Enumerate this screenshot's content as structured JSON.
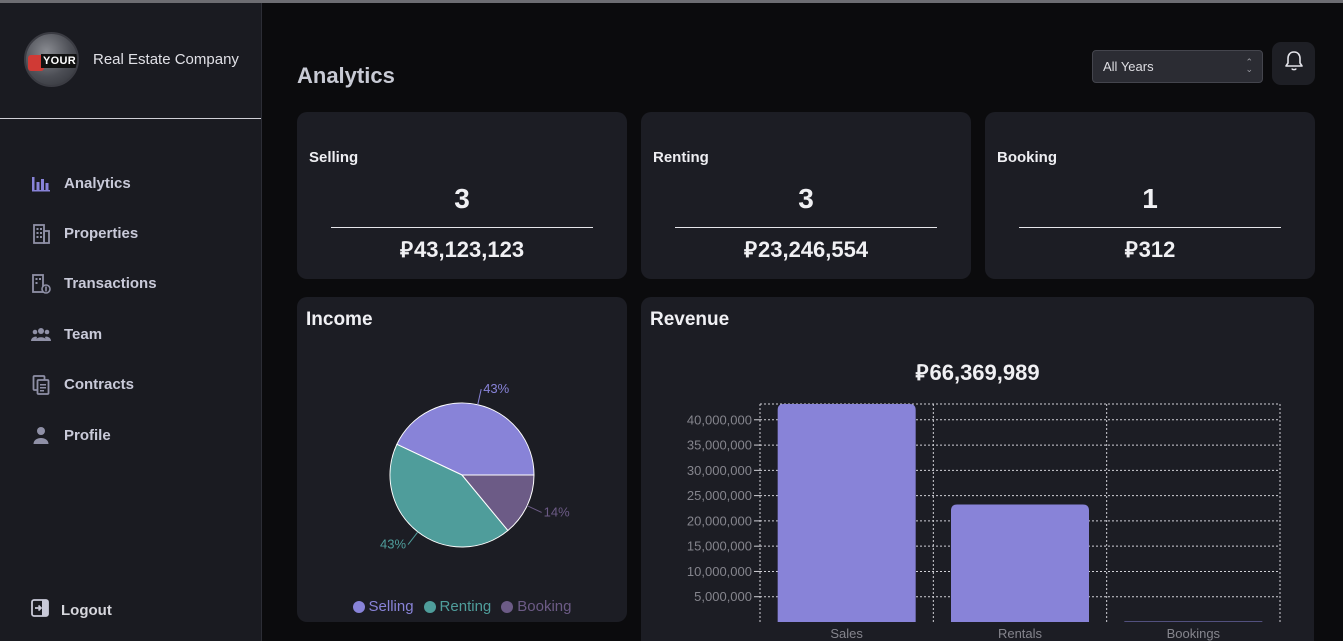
{
  "brand": {
    "name": "Real Estate Company",
    "logo_text": "YOUR"
  },
  "nav": [
    {
      "label": "Analytics",
      "icon": "bar-chart-icon",
      "active": true
    },
    {
      "label": "Properties",
      "icon": "building-icon",
      "active": false
    },
    {
      "label": "Transactions",
      "icon": "building-money-icon",
      "active": false
    },
    {
      "label": "Team",
      "icon": "team-icon",
      "active": false
    },
    {
      "label": "Contracts",
      "icon": "documents-icon",
      "active": false
    },
    {
      "label": "Profile",
      "icon": "user-icon",
      "active": false
    }
  ],
  "logout": {
    "label": "Logout",
    "icon": "logout-icon"
  },
  "header": {
    "title": "Analytics",
    "year_select": "All Years",
    "bell_icon": "bell-icon"
  },
  "currency_symbol": "⃁",
  "stats": [
    {
      "title": "Selling",
      "count": "3",
      "amount": "43,123,123"
    },
    {
      "title": "Renting",
      "count": "3",
      "amount": "23,246,554"
    },
    {
      "title": "Booking",
      "count": "1",
      "amount": "312"
    }
  ],
  "income": {
    "title": "Income",
    "chart_data": {
      "type": "pie",
      "slices": [
        {
          "label": "Selling",
          "percent": 43,
          "label_text": "43%",
          "color": "#8883d8"
        },
        {
          "label": "Renting",
          "percent": 43,
          "label_text": "43%",
          "color": "#4f9d9b"
        },
        {
          "label": "Booking",
          "percent": 14,
          "label_text": "14%",
          "color": "#6c5b86"
        }
      ],
      "legend": "bottom"
    }
  },
  "revenue": {
    "title": "Revenue",
    "total": "66,369,989",
    "chart_data": {
      "type": "bar",
      "categories": [
        "Sales",
        "Rentals",
        "Bookings"
      ],
      "values": [
        43123123,
        23246554,
        312
      ],
      "ylim": [
        0,
        43123123
      ],
      "yticks": [
        40000000,
        35000000,
        30000000,
        25000000,
        20000000,
        15000000,
        10000000,
        5000000
      ],
      "ytick_labels": [
        "40,000,000",
        "35,000,000",
        "30,000,000",
        "25,000,000",
        "20,000,000",
        "15,000,000",
        "10,000,000",
        "5,000,000"
      ],
      "grid": true,
      "bar_color": "#8883d8"
    }
  }
}
